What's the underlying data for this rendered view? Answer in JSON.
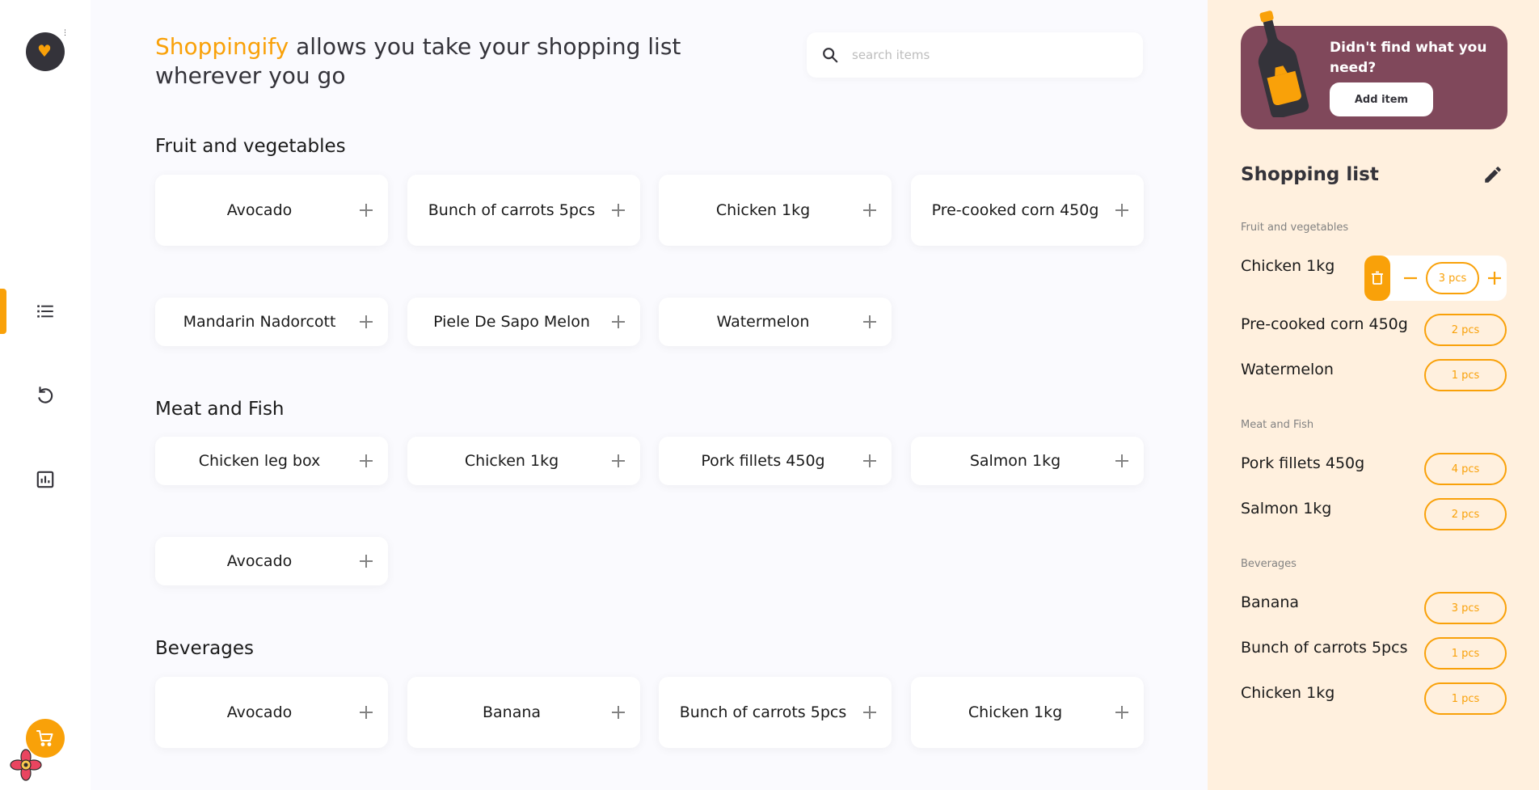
{
  "brand": {
    "accent": "#F9A109",
    "promo_bg": "#80485B",
    "panel_bg": "#FFF0DE",
    "dark": "#34333A"
  },
  "nav": {
    "items": [
      {
        "name": "items",
        "icon": "list-icon",
        "active": true
      },
      {
        "name": "history",
        "icon": "history-icon",
        "active": false
      },
      {
        "name": "statistics",
        "icon": "chart-icon",
        "active": false
      }
    ],
    "cart_icon": "cart-icon"
  },
  "header": {
    "brand_word": "Shoppingify",
    "tagline": " allows you take your shopping list wherever you go"
  },
  "search": {
    "placeholder": "search items",
    "value": ""
  },
  "categories": [
    {
      "title": "Fruit and vegetables",
      "items": [
        "Avocado",
        "Bunch of carrots 5pcs",
        "Chicken 1kg",
        "Pre-cooked corn 450g",
        "Mandarin Nadorcott",
        "Piele De Sapo Melon",
        "Watermelon"
      ]
    },
    {
      "title": "Meat and Fish",
      "items": [
        "Chicken leg box",
        "Chicken 1kg",
        "Pork fillets 450g",
        "Salmon 1kg",
        "Avocado"
      ]
    },
    {
      "title": "Beverages",
      "items": [
        "Avocado",
        "Banana",
        "Bunch of carrots 5pcs",
        "Chicken 1kg"
      ]
    }
  ],
  "promo": {
    "text": "Didn't find what you need?",
    "button": "Add item"
  },
  "shopping_list": {
    "title": "Shopping list",
    "groups": [
      {
        "title": "Fruit and vegetables",
        "items": [
          {
            "name": "Chicken 1kg",
            "qty": "3 pcs",
            "editing": true
          },
          {
            "name": "Pre-cooked corn 450g",
            "qty": "2 pcs"
          },
          {
            "name": "Watermelon",
            "qty": "1 pcs"
          }
        ]
      },
      {
        "title": "Meat and Fish",
        "items": [
          {
            "name": "Pork fillets 450g",
            "qty": "4 pcs"
          },
          {
            "name": "Salmon 1kg",
            "qty": "2 pcs"
          }
        ]
      },
      {
        "title": "Beverages",
        "items": [
          {
            "name": "Banana",
            "qty": "3 pcs"
          },
          {
            "name": "Bunch of carrots 5pcs",
            "qty": "1 pcs"
          },
          {
            "name": "Chicken 1kg",
            "qty": "1 pcs"
          }
        ]
      }
    ]
  }
}
